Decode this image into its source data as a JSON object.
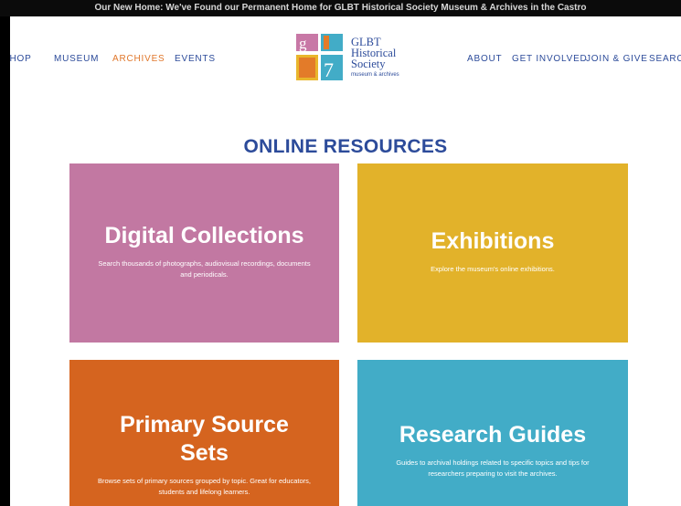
{
  "banner": {
    "text": "Our New Home: We've Found our Permanent Home for GLBT Historical Society Museum & Archives in the Castro"
  },
  "nav": {
    "left": [
      "SHOP",
      "MUSEUM",
      "ARCHIVES",
      "EVENTS"
    ],
    "right": [
      "ABOUT",
      "GET INVOLVED",
      "JOIN & GIVE",
      "SEARCH"
    ],
    "active": "ARCHIVES"
  },
  "logo": {
    "line1": "GLBT",
    "line2": "Historical",
    "line3": "Society",
    "sub": "museum & archives",
    "colors": {
      "pink": "#c878a6",
      "orange": "#e37b29",
      "yellow": "#e9b62c",
      "blue": "#42acc7"
    }
  },
  "section_title": "ONLINE RESOURCES",
  "cards": [
    {
      "title": "Digital Collections",
      "desc": "Search thousands of photographs, audiovisual recordings, documents and periodicals.",
      "color": "#c278a2"
    },
    {
      "title": "Exhibitions",
      "desc": "Explore the museum's online exhibitions.",
      "color": "#e2b22a"
    },
    {
      "title": "Primary Source Sets",
      "desc": "Browse sets of primary sources grouped by topic. Great for educators, students and lifelong learners.",
      "color": "#d5641f"
    },
    {
      "title": "Research Guides",
      "desc": "Guides to archival holdings related to specific topics and tips for researchers preparing to visit the archives.",
      "color": "#42acc7"
    }
  ]
}
